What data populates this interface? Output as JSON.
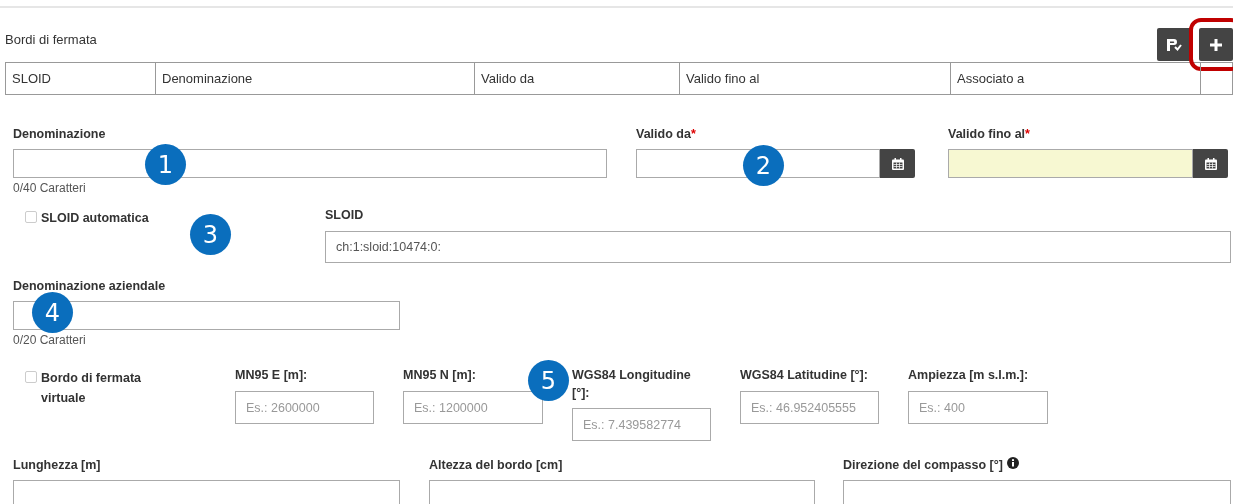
{
  "section": {
    "title": "Bordi di fermata"
  },
  "toolbar": [
    {
      "kind": "export",
      "highlighted": false
    },
    {
      "kind": "add",
      "highlighted": true
    }
  ],
  "table": {
    "columns": [
      "SLOID",
      "Denominazione",
      "Valido da",
      "Valido fino al",
      "Associato a"
    ]
  },
  "form_rows": [
    {
      "fields": [
        {
          "kind": "text",
          "label": "Denominazione",
          "counter": "0/40 Caratteri"
        },
        {
          "kind": "date",
          "label": "Valido da",
          "required_marker": "*",
          "highlighted": false
        },
        {
          "kind": "date",
          "label": "Valido fino al",
          "required_marker": "*",
          "highlighted": true
        }
      ]
    },
    {
      "fields": [
        {
          "kind": "checkbox",
          "label": "SLOID automatica",
          "checked": false
        },
        {
          "kind": "text",
          "label": "SLOID",
          "value": "ch:1:sloid:10474:0:"
        }
      ]
    },
    {
      "fields": [
        {
          "kind": "text",
          "label": "Denominazione aziendale",
          "counter": "0/20 Caratteri"
        }
      ]
    },
    {
      "fields": [
        {
          "kind": "checkbox",
          "label": "Bordo di fermata virtuale",
          "checked": false
        },
        {
          "kind": "text",
          "label": "MN95 E [m]:",
          "placeholder": "Es.: 2600000"
        },
        {
          "kind": "text",
          "label": "MN95 N [m]:",
          "placeholder": "Es.: 1200000"
        },
        {
          "kind": "text",
          "label": "WGS84 Longitudine [°]:",
          "placeholder": "Es.: 7.439582774"
        },
        {
          "kind": "text",
          "label": "WGS84 Latitudine [°]:",
          "placeholder": "Es.: 46.952405555"
        },
        {
          "kind": "text",
          "label": "Ampiezza [m s.l.m.]:",
          "placeholder": "Es.: 400"
        }
      ]
    },
    {
      "fields": [
        {
          "kind": "text",
          "label": "Lunghezza [m]"
        },
        {
          "kind": "text",
          "label": "Altezza del bordo [cm]"
        },
        {
          "kind": "text",
          "label": "Direzione del compasso [°]",
          "info": true
        }
      ]
    }
  ],
  "callouts": [
    "1",
    "2",
    "3",
    "4",
    "5"
  ]
}
